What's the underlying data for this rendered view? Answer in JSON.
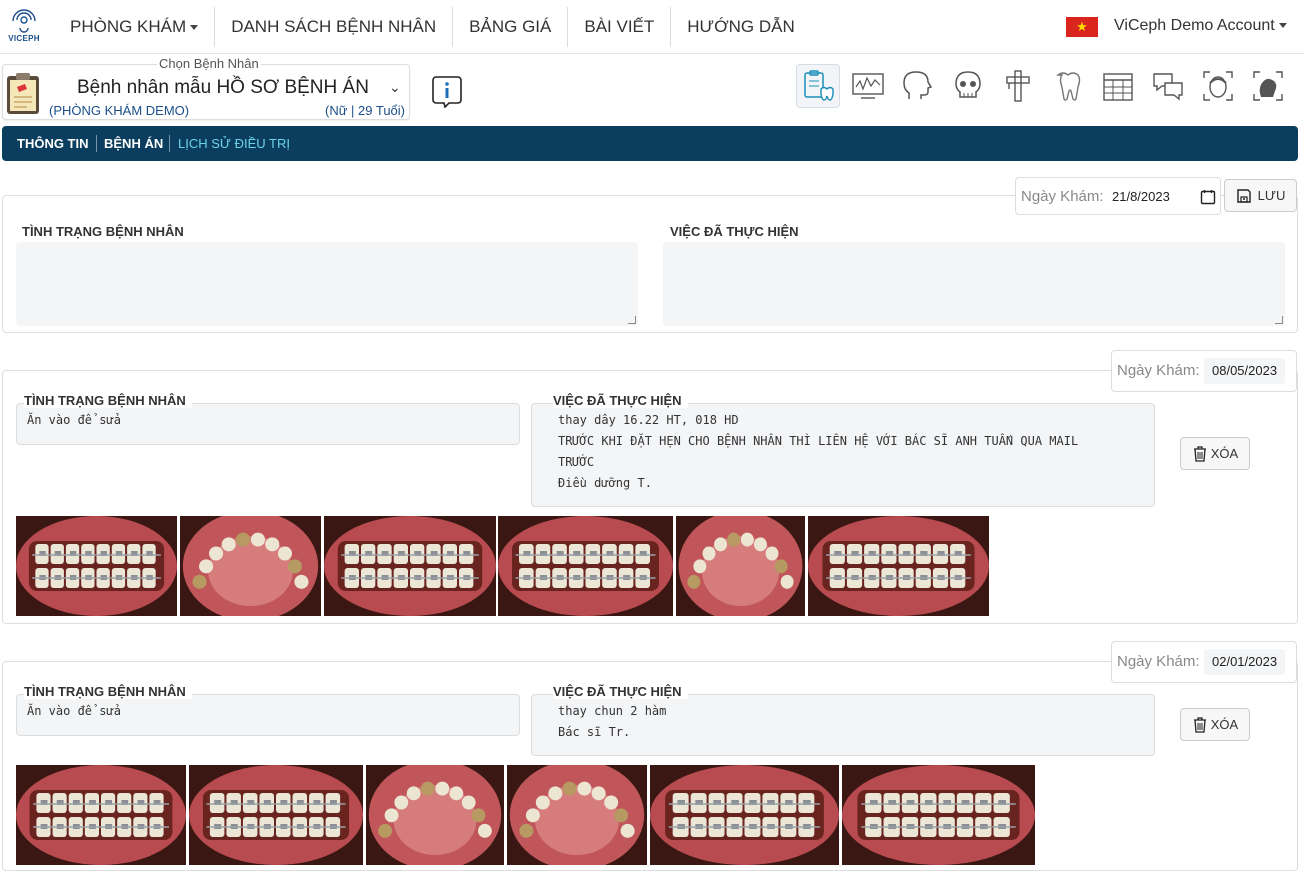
{
  "brand": {
    "name": "VICEPH"
  },
  "nav": {
    "menu": [
      "PHÒNG KHÁM",
      "DANH SÁCH BỆNH NHÂN",
      "BẢNG GIÁ",
      "BÀI VIẾT",
      "HƯỚNG DẪN"
    ],
    "account": "ViCeph Demo Account",
    "flag_colors": {
      "red": "#da251d",
      "star": "#ffde00"
    }
  },
  "patient": {
    "legend": "Chọn Bệnh Nhân",
    "name": "Bệnh nhân mẫu HỒ SƠ BỆNH ÁN",
    "clinic": "(PHÒNG KHÁM DEMO)",
    "meta": "(Nữ | 29 Tuổi)"
  },
  "tools": [
    "treatment-record-icon",
    "ceph-chart-icon",
    "head-profile-icon",
    "skull-icon",
    "caliper-icon",
    "tooth-icon",
    "calendar-grid-icon",
    "chat-icon",
    "face-scan-icon",
    "head-scan-icon"
  ],
  "tabs": [
    "THÔNG TIN",
    "BỆNH ÁN",
    "LỊCH SỬ ĐIỀU TRỊ"
  ],
  "new_entry": {
    "date_label": "Ngày Khám:",
    "date_value": "21/8/2023",
    "save_label": "LƯU",
    "status_label": "TÌNH TRẠNG BỆNH NHÂN",
    "done_label": "VIỆC ĐÃ THỰC HIỆN",
    "status_value": "",
    "done_value": ""
  },
  "records": [
    {
      "date_label": "Ngày Khám:",
      "date_value": "08/05/2023",
      "status_label": "TÌNH TRẠNG BỆNH NHÂN",
      "status_text": "Ăn vào để sửa",
      "done_label": "VIỆC ĐÃ THỰC HIỆN",
      "done_lines": [
        "thay dây 16.22 HT, 018 HD",
        "TRƯỚC KHI ĐẶT HẸN CHO BỆNH NHÂN THÌ LIÊN HỆ VỚI BÁC SĨ ANH TUẤN QUA MAIL",
        "TRƯỚC",
        "Điều dưỡng T."
      ],
      "delete_label": "XÓA",
      "photos": [
        "right-occlusion",
        "upper-arch",
        "front-open",
        "front-open-wide",
        "lower-arch",
        "left-occlusion"
      ]
    },
    {
      "date_label": "Ngày Khám:",
      "date_value": "02/01/2023",
      "status_label": "TÌNH TRẠNG BỆNH NHÂN",
      "status_text": "Ăn vào để sửa",
      "done_label": "VIỆC ĐÃ THỰC HIỆN",
      "done_lines": [
        "thay chun 2 hàm",
        "Bác sĩ Tr."
      ],
      "delete_label": "XÓA",
      "photos": [
        "front-occlusion",
        "right-occlusion",
        "upper-arch",
        "lower-arch",
        "front-occlusion",
        "left-occlusion"
      ]
    }
  ],
  "colors": {
    "tabbar": "#0b3d5e",
    "tab_selected": "#6cd4e6",
    "accent_blue": "#1c4f8a"
  }
}
